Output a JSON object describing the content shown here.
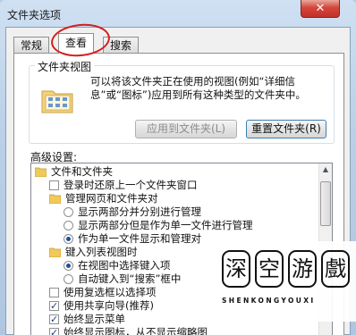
{
  "window": {
    "title": "文件夹选项",
    "close_glyph": "✕"
  },
  "tabs": [
    {
      "label": "常规",
      "active": false
    },
    {
      "label": "查看",
      "active": true
    },
    {
      "label": "搜索",
      "active": false
    }
  ],
  "folder_views": {
    "legend": "文件夹视图",
    "description": "可以将该文件夹正在使用的视图(例如“详细信息”或“图标”)应用到所有这种类型的文件夹中。",
    "apply_button": "应用到文件夹(L)",
    "reset_button": "重置文件夹(R)"
  },
  "advanced": {
    "label": "高级设置:",
    "items": [
      {
        "type": "folder",
        "label": "文件和文件夹",
        "checked": false
      },
      {
        "type": "check",
        "label": "登录时还原上一个文件夹窗口",
        "checked": false
      },
      {
        "type": "folder",
        "label": "管理网页和文件夹对",
        "checked": false
      },
      {
        "type": "radio",
        "label": "显示两部分并分别进行管理",
        "checked": false
      },
      {
        "type": "radio",
        "label": "显示两部分但是作为单一文件进行管理",
        "checked": false
      },
      {
        "type": "radio",
        "label": "作为单一文件显示和管理对",
        "checked": true
      },
      {
        "type": "folder",
        "label": "键入列表视图时",
        "checked": false
      },
      {
        "type": "radio",
        "label": "在视图中选择键入项",
        "checked": true
      },
      {
        "type": "radio",
        "label": "自动键入到“搜索”框中",
        "checked": false
      },
      {
        "type": "check",
        "label": "使用复选框以选择项",
        "checked": false
      },
      {
        "type": "check",
        "label": "使用共享向导(推荐)",
        "checked": true
      },
      {
        "type": "check",
        "label": "始终显示菜单",
        "checked": true
      },
      {
        "type": "check",
        "label": "始终显示图标，从不显示缩略图",
        "checked": true
      }
    ]
  },
  "watermark": {
    "chars": [
      "深",
      "空",
      "游",
      "戲"
    ],
    "subtitle": "SHENKONGYOUXI"
  }
}
